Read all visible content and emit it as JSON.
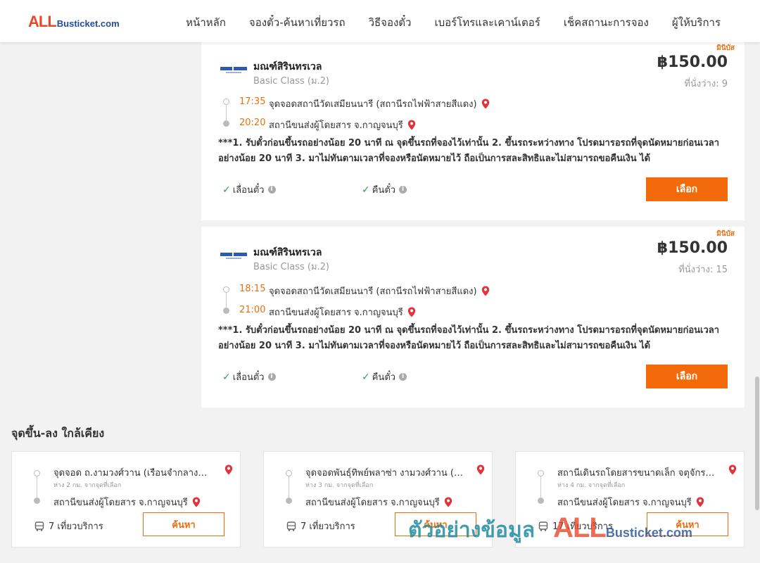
{
  "header": {
    "logo_all": "ALL",
    "logo_rest": "Busticket.com",
    "nav": [
      "หน้าหลัก",
      "จองตั๋ว-ค้นหาเที่ยวรถ",
      "วิธีจองตั๋ว",
      "เบอร์โทรและเคาน์เตอร์",
      "เช็คสถานะการจอง",
      "ผู้ให้บริการ"
    ]
  },
  "trips": [
    {
      "bus_type": "มินิบัส",
      "operator": "มณฑ์สิรินทรเวล",
      "class": "Basic Class (ม.2)",
      "price": "฿150.00",
      "seats": "ที่นั่งว่าง: 9",
      "depart_time": "17:35",
      "depart_stop": "จุดจอดสถานีวัดเสมียนนารี (สถานีรถไฟฟ้าสายสีแดง)",
      "arrive_time": "20:20",
      "arrive_stop": "สถานีขนส่งผู้โดยสาร จ.กาญจนบุรี",
      "conditions": "***1. รับตั๋วก่อนขึ้นรถอย่างน้อย 20 นาที ณ จุดขึ้นรถที่จองไว้เท่านั้น 2. ขึ้นรถระหว่างทาง โปรดมารอรถที่จุดนัดหมายก่อนเวลาอย่างน้อย 20 นาที 3. มาไม่ทันตามเวลาที่จองหรือนัดหมายไว้ ถือเป็นการสละสิทธิและไม่สามารถขอคืนเงิน ได้",
      "change_label": "เลื่อนตั๋ว",
      "refund_label": "คืนตั๋ว",
      "select_label": "เลือก"
    },
    {
      "bus_type": "มินิบัส",
      "operator": "มณฑ์สิรินทรเวล",
      "class": "Basic Class (ม.2)",
      "price": "฿150.00",
      "seats": "ที่นั่งว่าง: 15",
      "depart_time": "18:15",
      "depart_stop": "จุดจอดสถานีวัดเสมียนนารี (สถานีรถไฟฟ้าสายสีแดง)",
      "arrive_time": "21:00",
      "arrive_stop": "สถานีขนส่งผู้โดยสาร จ.กาญจนบุรี",
      "conditions": "***1. รับตั๋วก่อนขึ้นรถอย่างน้อย 20 นาที ณ จุดขึ้นรถที่จองไว้เท่านั้น 2. ขึ้นรถระหว่างทาง โปรดมารอรถที่จุดนัดหมายก่อนเวลาอย่างน้อย 20 นาที 3. มาไม่ทันตามเวลาที่จองหรือนัดหมายไว้ ถือเป็นการสละสิทธิและไม่สามารถขอคืนเงิน ได้",
      "change_label": "เลื่อนตั๋ว",
      "refund_label": "คืนตั๋ว",
      "select_label": "เลือก"
    }
  ],
  "nearby": {
    "title": "จุดขึ้น-ลง ใกล้เคียง",
    "items": [
      {
        "from": "จุดจอด ถ.งามวงศ์วาน (เรือนจำกลางคลองเปรม)",
        "distance": "ห่าง 2 กม. จากจุดที่เลือก",
        "to": "สถานีขนส่งผู้โดยสาร จ.กาญจนบุรี",
        "services": "7 เที่ยวบริการ",
        "search_label": "ค้นหา"
      },
      {
        "from": "จุดจอดพันธุ์ทิพย์พลาซ่า งามวงศ์วาน (แคราย)",
        "distance": "ห่าง 3 กม. จากจุดที่เลือก",
        "to": "สถานีขนส่งผู้โดยสาร จ.กาญจนบุรี",
        "services": "7 เที่ยวบริการ",
        "search_label": "ค้นหา"
      },
      {
        "from": "สถานีเดินรถโดยสารขนาดเล็ก จตุจักร (หมอชิต)",
        "distance": "ห่าง 4 กม. จากจุดที่เลือก",
        "to": "สถานีขนส่งผู้โดยสาร จ.กาญจนบุรี",
        "services": "17 เที่ยวบริการ",
        "search_label": "ค้นหา"
      }
    ]
  },
  "watermark": {
    "text": "ตัวอย่างข้อมูล",
    "all": "ALL",
    "rest": "Busticket.com"
  },
  "colors": {
    "accent": "#f26a0a",
    "time": "#e87011",
    "check": "#2f9e44",
    "pin": "#e0353d"
  }
}
